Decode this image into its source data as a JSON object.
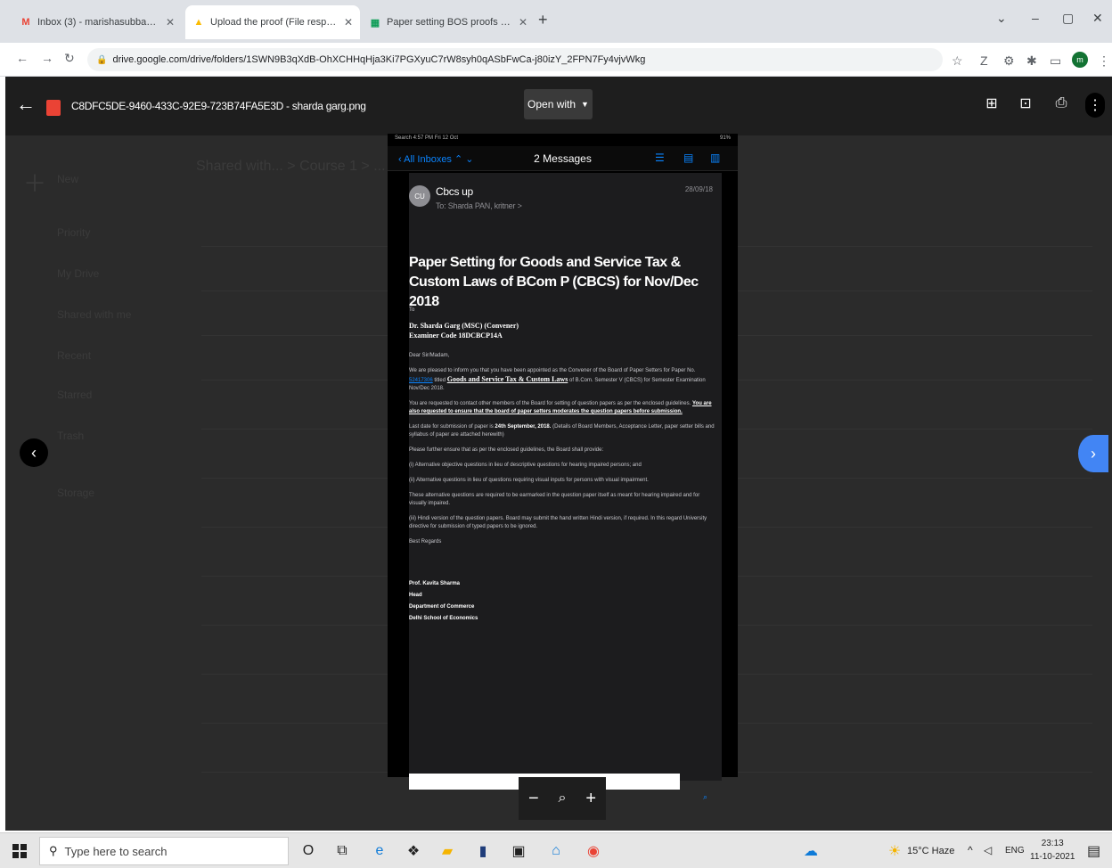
{
  "browser": {
    "tabs": [
      {
        "label": "Inbox (3) - marishasubba@ms...",
        "icon_color": "#ea4335",
        "icon_glyph": "M"
      },
      {
        "label": "Upload the proof (File responses...",
        "icon_color": "#fbbc04",
        "icon_glyph": "▲"
      },
      {
        "label": "Paper setting BOS proofs (Resp...",
        "icon_color": "#0f9d58",
        "icon_glyph": "▦"
      }
    ],
    "new_tab": "+",
    "url": "drive.google.com/drive/folders/1SWN9B3qXdB-OhXCHHqHja3Ki7PGXyuC7rW8syh0qASbFwCa-j80izY_2FPN7Fy4vjvWkg",
    "profile_initial": "m"
  },
  "viewer": {
    "filename": "C8DFC5DE-9460-433C-92E9-723B74FA5E3D - sharda garg.png",
    "open_with": "Open with"
  },
  "phone": {
    "status_left": "Search 4:57 PM Fri 12 Oct",
    "status_right": "91%",
    "back_label": "All Inboxes",
    "messages_title": "2 Messages",
    "sender": "Cbcs up",
    "to_line": "To: Sharda PAN, kritner >",
    "date": "28/09/18",
    "avatar": "CU",
    "subject": "Paper Setting for Goods and Service Tax & Custom Laws of BCom P (CBCS) for Nov/Dec 2018",
    "body": {
      "to": "To",
      "addressee_name": "Dr. Sharda Garg (MSC) (Convener)",
      "examiner_code": "Examiner Code 18DCBCP14A",
      "greeting": "Dear Sir/Madam,",
      "p1_a": "We are pleased to inform you that you have been appointed as the Convener of the Board of Paper Setters for Paper No.",
      "p1_code": "52417306",
      "p1_b": "titled",
      "p1_title": "Goods and Service Tax & Custom Laws",
      "p1_c": "of B.Com. Semester V (CBCS) for Semester Examination Nov/Dec 2018.",
      "p2_a": "You are requested to contact other members of the Board for setting of question papers as per the enclosed guidelines.",
      "p2_u": "You are also requested to ensure that the board of paper setters moderates the question papers before submission.",
      "p3_a": "Last date for submission of paper is",
      "p3_b": "24th September, 2018.",
      "p3_c": "(Details of Board Members, Acceptance Letter, paper setter bills and syllabus of paper are attached herewith)",
      "p4": "Please further ensure that as per the enclosed guidelines, the Board shall provide:",
      "p5": "(i) Alternative objective questions in lieu of descriptive questions for hearing impaired persons; and",
      "p6": "(ii) Alternative questions in lieu of questions requiring visual inputs for persons with visual impairment.",
      "p7": "These alternative questions are required to be earmarked in the question paper itself as meant for hearing impaired and for visually impaired.",
      "p8": "(iii) Hindi version of the question papers. Board may submit the hand written Hindi version, if required. In this regard University directive for submission of typed papers to be ignored.",
      "regards": "Best Regards",
      "sig_name": "Prof. Kavita Sharma",
      "sig_title": "Head",
      "sig_dept": "Department of Commerce",
      "sig_school": "Delhi School of Economics"
    }
  },
  "zoom": {
    "minus": "−",
    "plus": "+"
  },
  "drive_bg": {
    "breadcrumb": "Shared with... > Course 1 > ...",
    "new_label": "New",
    "sidebar": [
      "Priority",
      "My Drive",
      "Shared with me",
      "Recent",
      "Starred",
      "Trash",
      "Storage"
    ]
  },
  "taskbar": {
    "search_placeholder": "Type here to search",
    "weather": "15°C Haze",
    "lang": "ENG",
    "time": "23:13",
    "date": "11-10-2021"
  }
}
